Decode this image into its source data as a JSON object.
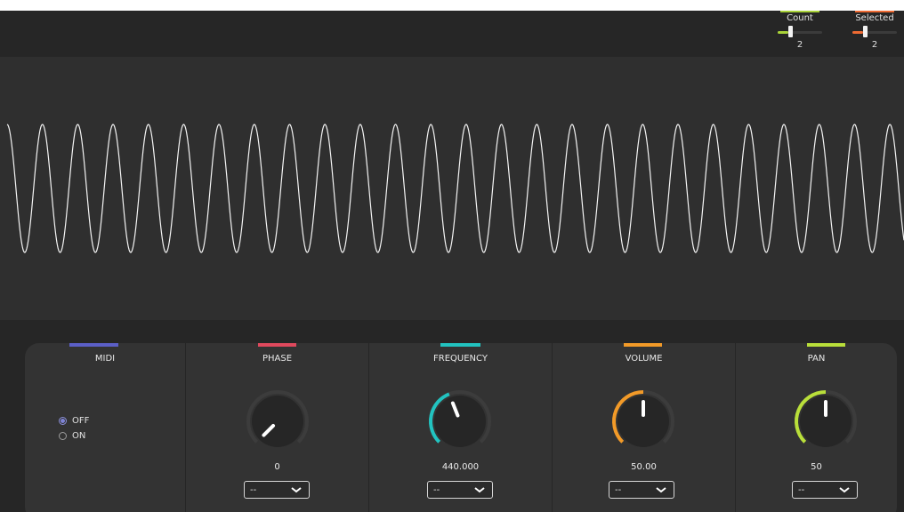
{
  "header": {
    "count": {
      "label": "Count",
      "value": "2",
      "fraction": 0.24,
      "accent": "#a9d338"
    },
    "selected": {
      "label": "Selected",
      "value": "2",
      "fraction": 0.24,
      "accent": "#ee6a32"
    }
  },
  "waveform": {
    "cycles": 25.4,
    "color": "#f4f4f4",
    "background": "#2f2f2f"
  },
  "midi": {
    "title": "MIDI",
    "accent": "#5b5fc7",
    "options": [
      {
        "label": "OFF",
        "selected": true
      },
      {
        "label": "ON",
        "selected": false
      }
    ]
  },
  "knobs": [
    {
      "title": "PHASE",
      "accent": "#e0495d",
      "value": "0",
      "fraction": 0.0,
      "select_value": "--"
    },
    {
      "title": "FREQUENCY",
      "accent": "#22c3c0",
      "value": "440.000",
      "fraction": 0.42,
      "select_value": "--"
    },
    {
      "title": "VOLUME",
      "accent": "#f29a28",
      "value": "50.00",
      "fraction": 0.5,
      "select_value": "--"
    },
    {
      "title": "PAN",
      "accent": "#b9df3a",
      "value": "50",
      "fraction": 0.5,
      "select_value": "--"
    }
  ]
}
